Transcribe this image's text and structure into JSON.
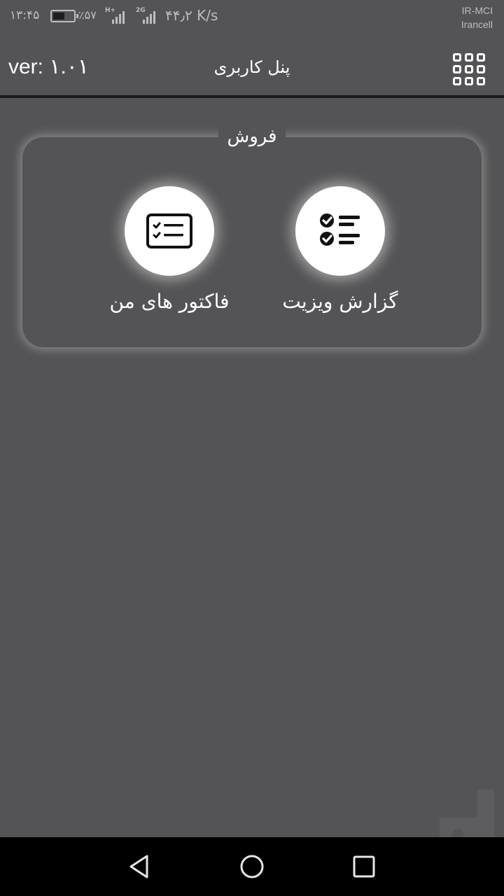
{
  "status_bar": {
    "time": "۱۳:۴۵",
    "battery_percent": "٪۵۷",
    "network_1": "H+",
    "network_2": "2G",
    "speed": "۴۴٫۲ K/s",
    "carrier_1": "IR-MCI",
    "carrier_2": "Irancell"
  },
  "app_bar": {
    "version": "ver: ۱.۰۱",
    "title": "پنل کاربری",
    "menu_icon": "grid-icon"
  },
  "sales_section": {
    "title": "فروش",
    "actions": [
      {
        "label": "گزارش ویزیت",
        "icon": "checklist-icon"
      },
      {
        "label": "فاکتور های من",
        "icon": "invoice-card-icon"
      }
    ]
  },
  "nav_bar": {
    "back_icon": "back-triangle-icon",
    "home_icon": "home-circle-icon",
    "recent_icon": "recent-square-icon"
  },
  "colors": {
    "background": "#545456",
    "divider": "#1c1c1c",
    "nav_background": "#000000",
    "icon_circle": "#ffffff"
  }
}
